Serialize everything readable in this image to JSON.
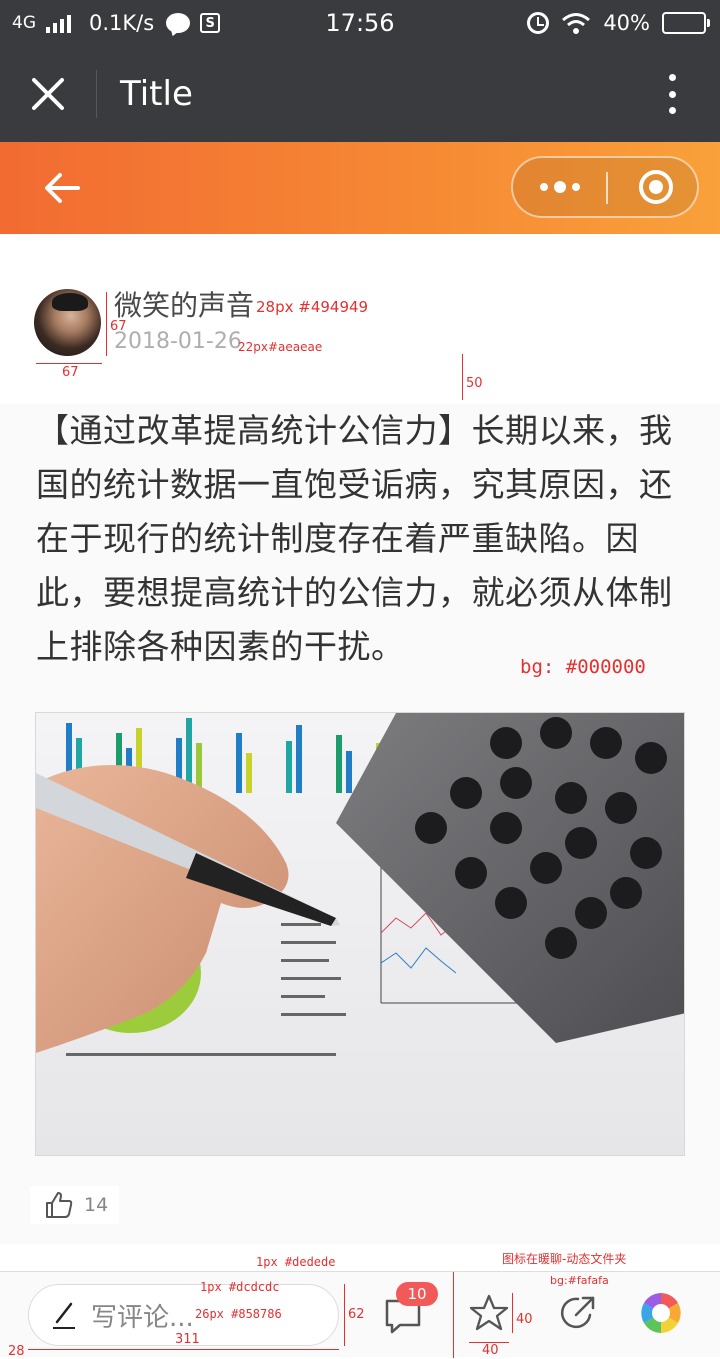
{
  "status_bar": {
    "network": "4G",
    "speed": "0.1K/s",
    "sim_label": "S",
    "time": "17:56",
    "battery": "40%",
    "battery_level": 0.4
  },
  "title_bar": {
    "title": "Title"
  },
  "author": {
    "name": "微笑的声音",
    "date": "2018-01-26"
  },
  "article": {
    "text": "【通过改革提高统计公信力】长期以来，我国的统计数据一直饱受诟病，究其原因，还在于现行的统计制度存在着严重缺陷。因此，要想提高统计的公信力，就必须从体制上排除各种因素的干扰。",
    "likes": "14"
  },
  "bottom_bar": {
    "comment_placeholder": "写评论...",
    "comment_count": "10"
  },
  "annotations": {
    "name_spec": "28px #494949",
    "date_spec": "22px#aeaeae",
    "avatar_width": "67",
    "avatar_height": "67",
    "gap_below": "50",
    "bg_note": "bg: #000000",
    "bar_border": "1px #dedede",
    "folder_note": "图标在暖聊-动态文件夹",
    "bar_bg": "bg:#fafafa",
    "input_border": "1px #dcdcdc",
    "input_text": "26px #858786",
    "input_height": "62",
    "input_width": "311",
    "input_left": "28",
    "icon_size": "40",
    "icon_width": "40"
  },
  "colors": {
    "topbar": "#3a3b3e",
    "accent_orange": "#f68a34",
    "name_color": "#494949",
    "date_color": "#aeaeae",
    "placeholder_color": "#858786",
    "badge": "#f25a5a",
    "annotation": "#e53030"
  },
  "icons": [
    "close-icon",
    "more-vertical-icon",
    "back-arrow-icon",
    "capsule-more-icon",
    "capsule-close-icon",
    "thumbs-up-icon",
    "pen-icon",
    "comment-icon",
    "star-icon",
    "share-icon",
    "folder-color-icon"
  ]
}
